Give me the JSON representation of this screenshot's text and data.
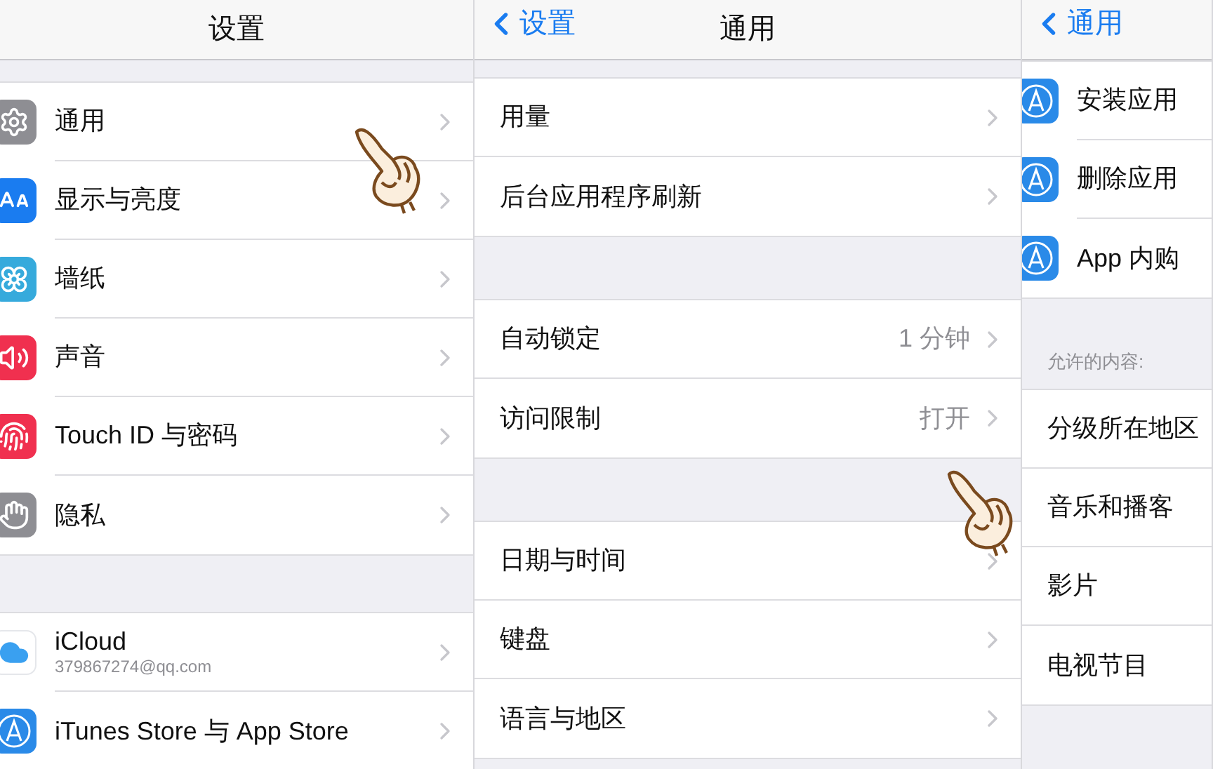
{
  "panels": [
    {
      "header": {
        "title": "设置"
      },
      "sections": [
        {
          "items": [
            {
              "kind": "gear",
              "label": "通用",
              "chevron": true
            },
            {
              "kind": "text-size",
              "label": "显示与亮度",
              "chevron": true
            },
            {
              "kind": "flower",
              "label": "墙纸",
              "chevron": true
            },
            {
              "kind": "speaker",
              "label": "声音",
              "chevron": true
            },
            {
              "kind": "fingerprint",
              "label": "Touch ID 与密码",
              "chevron": true
            },
            {
              "kind": "hand",
              "label": "隐私",
              "chevron": true
            }
          ]
        },
        {
          "items": [
            {
              "kind": "cloud",
              "label": "iCloud",
              "subtitle": "379867274@qq.com",
              "chevron": true
            },
            {
              "kind": "appstore",
              "label": "iTunes Store 与 App Store",
              "chevron": true
            }
          ]
        }
      ]
    },
    {
      "header": {
        "back": "设置",
        "title": "通用"
      },
      "sections": [
        {
          "items": [
            {
              "label": "用量",
              "chevron": true
            },
            {
              "label": "后台应用程序刷新",
              "chevron": true
            }
          ]
        },
        {
          "items": [
            {
              "label": "自动锁定",
              "value": "1 分钟",
              "chevron": true
            },
            {
              "label": "访问限制",
              "value": "打开",
              "chevron": true
            }
          ]
        },
        {
          "items": [
            {
              "label": "日期与时间",
              "chevron": true
            },
            {
              "label": "键盘",
              "chevron": true
            },
            {
              "label": "语言与地区",
              "chevron": true
            }
          ]
        }
      ]
    },
    {
      "header": {
        "back": "通用"
      },
      "sections": [
        {
          "items": [
            {
              "kind": "appstore",
              "label": "安装应用"
            },
            {
              "kind": "appstore",
              "label": "删除应用"
            },
            {
              "kind": "appstore",
              "label": "App 内购"
            }
          ]
        },
        {
          "label": "允许的内容:",
          "items": [
            {
              "label": "分级所在地区"
            },
            {
              "label": "音乐和播客"
            },
            {
              "label": "影片"
            },
            {
              "label": "电视节目"
            }
          ]
        }
      ]
    }
  ]
}
